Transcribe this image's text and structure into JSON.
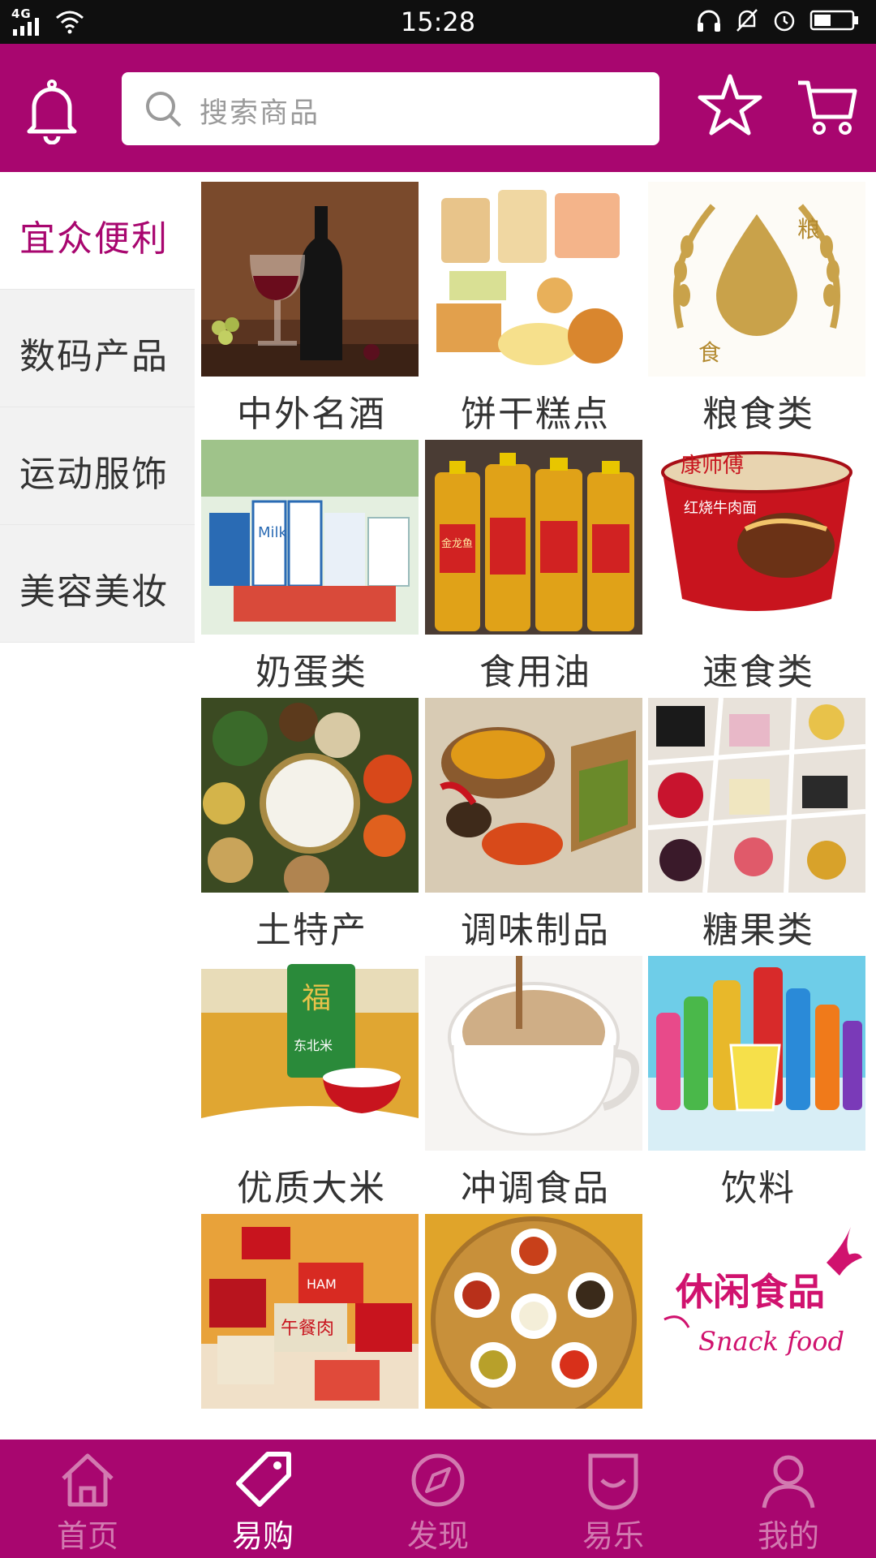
{
  "status_bar": {
    "network": "4G",
    "time": "15:28"
  },
  "search": {
    "placeholder": "搜索商品"
  },
  "sidebar": {
    "items": [
      {
        "label": "宜众便利",
        "active": true
      },
      {
        "label": "数码产品",
        "active": false
      },
      {
        "label": "运动服饰",
        "active": false
      },
      {
        "label": "美容美妆",
        "active": false
      }
    ]
  },
  "categories": [
    {
      "label": "中外名酒"
    },
    {
      "label": "饼干糕点"
    },
    {
      "label": "粮食类",
      "image_text_1": "粮",
      "image_text_2": "食"
    },
    {
      "label": "奶蛋类",
      "image_text": "Milk"
    },
    {
      "label": "食用油",
      "image_text": "金龙鱼"
    },
    {
      "label": "速食类",
      "image_text_1": "康师傅",
      "image_text_2": "红烧牛肉面"
    },
    {
      "label": "土特产"
    },
    {
      "label": "调味制品"
    },
    {
      "label": "糖果类"
    },
    {
      "label": "优质大米",
      "image_text_1": "福",
      "image_text_2": "东北米"
    },
    {
      "label": "冲调食品"
    },
    {
      "label": "饮料"
    },
    {
      "label": "",
      "image_text_1": "午餐肉",
      "image_text_2": "HAM"
    },
    {
      "label": ""
    },
    {
      "label": "",
      "image_text_1": "休闲食品",
      "image_text_2": "Snack food"
    }
  ],
  "tabbar": {
    "items": [
      {
        "label": "首页",
        "icon": "home-icon",
        "active": false
      },
      {
        "label": "易购",
        "icon": "tag-icon",
        "active": true
      },
      {
        "label": "发现",
        "icon": "compass-icon",
        "active": false
      },
      {
        "label": "易乐",
        "icon": "smile-icon",
        "active": false
      },
      {
        "label": "我的",
        "icon": "user-icon",
        "active": false
      }
    ]
  },
  "colors": {
    "brand": "#a8066f",
    "sidebar_bg": "#f2f2f2",
    "tab_inactive": "#d27ab0"
  }
}
